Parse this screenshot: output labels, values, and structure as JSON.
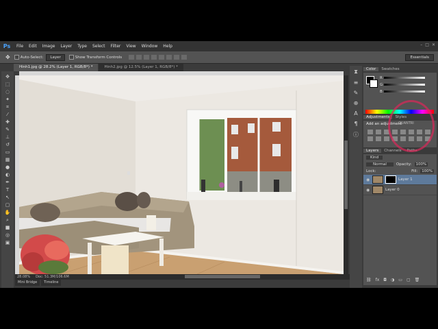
{
  "menu": {
    "logo": "Ps",
    "items": [
      "File",
      "Edit",
      "Image",
      "Layer",
      "Type",
      "Select",
      "Filter",
      "View",
      "Window",
      "Help"
    ]
  },
  "options": {
    "auto_select": "Auto-Select:",
    "auto_select_value": "Layer",
    "show_transform": "Show Transform Controls",
    "workspace": "Essentials"
  },
  "tabs": [
    {
      "label": "Hinh1.jpg @ 28.2% (Layer 1, RGB/8*) *"
    },
    {
      "label": "Hinh2.jpg @ 12.5% (Layer 1, RGB/8*) *"
    }
  ],
  "status": {
    "zoom": "28.08%",
    "doc": "Doc: 51.3M/106.6M"
  },
  "bottom_tabs": [
    "Mini Bridge",
    "Timeline"
  ],
  "panels": {
    "color_tabs": [
      "Color",
      "Swatches"
    ],
    "channels": [
      "R",
      "G",
      "B"
    ],
    "adjust_tabs": [
      "Adjustments",
      "Styles"
    ],
    "adjust_title": "Add an adjustment",
    "layer_tabs": [
      "Layers",
      "Channels",
      "Paths"
    ],
    "kind": "Kind",
    "blend": "Normal",
    "opacity_label": "Opacity:",
    "opacity": "100%",
    "lock_label": "Lock:",
    "fill_label": "Fill:",
    "fill": "100%",
    "layers": [
      {
        "name": "Layer 1"
      },
      {
        "name": "Layer 0"
      }
    ]
  },
  "watermark": "QUANTRI"
}
